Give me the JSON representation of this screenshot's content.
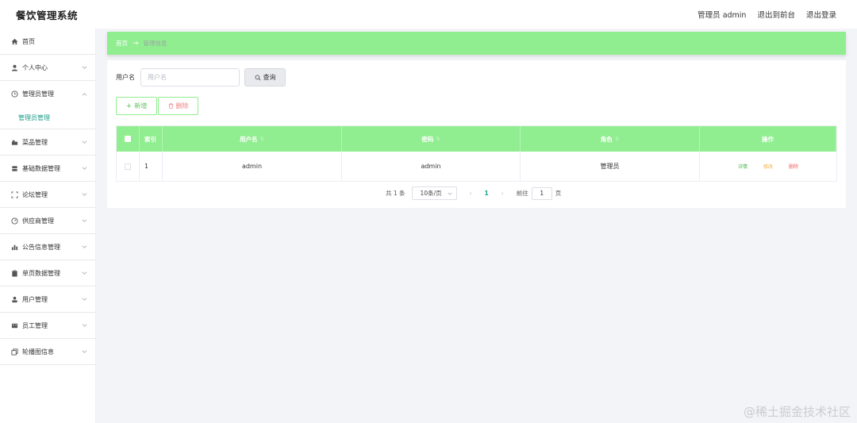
{
  "header": {
    "title": "餐饮管理系统",
    "user_label": "管理员 admin",
    "to_front_label": "退出到前台",
    "logout_label": "退出登录"
  },
  "sidebar": {
    "items": [
      {
        "label": "首页",
        "icon": "home-icon"
      },
      {
        "label": "个人中心",
        "icon": "user-icon"
      },
      {
        "label": "管理员管理",
        "icon": "clock-icon"
      },
      {
        "label": "菜品管理",
        "icon": "dish-icon"
      },
      {
        "label": "基础数据管理",
        "icon": "database-icon"
      },
      {
        "label": "论坛管理",
        "icon": "frame-icon"
      },
      {
        "label": "供应商管理",
        "icon": "gauge-icon"
      },
      {
        "label": "公告信息管理",
        "icon": "chart-icon"
      },
      {
        "label": "单页数据管理",
        "icon": "clipboard-icon"
      },
      {
        "label": "用户管理",
        "icon": "person-icon"
      },
      {
        "label": "员工管理",
        "icon": "staff-icon"
      },
      {
        "label": "轮播图信息",
        "icon": "copy-icon"
      }
    ],
    "submenu_label": "管理员管理"
  },
  "breadcrumb": {
    "home": "首页",
    "arrow": "→",
    "current": "管理信息"
  },
  "search": {
    "label": "用户名",
    "placeholder": "用户名",
    "value": "",
    "query_label": "查询"
  },
  "actions": {
    "add_label": "新增",
    "delete_label": "删除"
  },
  "table": {
    "headers": {
      "index": "索引",
      "username": "用户名",
      "password": "密码",
      "role": "角色",
      "operations": "操作"
    },
    "rows": [
      {
        "index": "1",
        "username": "admin",
        "password": "admin",
        "role": "管理员"
      }
    ],
    "op_detail": "详情",
    "op_edit": "修改",
    "op_delete": "删除"
  },
  "pagination": {
    "total": "共 1 条",
    "page_size": "10条/页",
    "current_page": "1",
    "goto_label": "前往",
    "goto_value": "1",
    "page_unit": "页"
  },
  "watermark": "@稀土掘金技术社区",
  "colors": {
    "accent_green": "#90ee90",
    "active_teal": "#1a9e8a"
  }
}
